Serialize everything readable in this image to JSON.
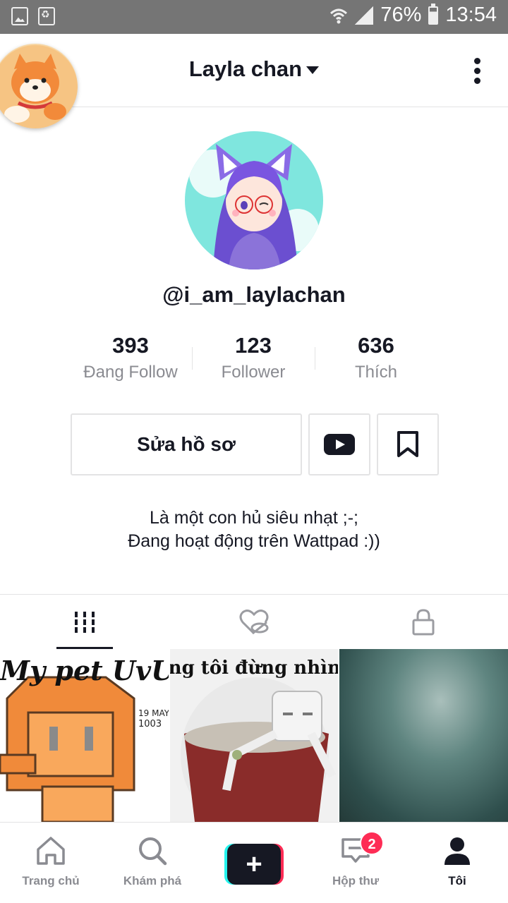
{
  "status_bar": {
    "battery": "76%",
    "time": "13:54"
  },
  "header": {
    "title": "Layla chan"
  },
  "profile": {
    "username": "@i_am_laylachan",
    "stats": [
      {
        "value": "393",
        "label": "Đang Follow"
      },
      {
        "value": "123",
        "label": "Follower"
      },
      {
        "value": "636",
        "label": "Thích"
      }
    ],
    "edit_button": "Sửa hồ sơ",
    "bio_line1": "Là một con hủ siêu nhạt ;-;",
    "bio_line2": "Đang hoạt động trên Wattpad :))"
  },
  "videos": [
    {
      "caption": "My pet UvU"
    },
    {
      "caption": "ng tôi đừng nhìn nữa"
    },
    {
      "caption": ""
    }
  ],
  "bottom_nav": {
    "items": [
      {
        "label": "Trang chủ"
      },
      {
        "label": "Khám phá"
      },
      {
        "label": "Hộp thư",
        "badge": "2"
      },
      {
        "label": "Tôi"
      }
    ]
  },
  "colors": {
    "accent_red": "#fe2c55",
    "accent_cyan": "#25f4ee",
    "text_primary": "#161823",
    "text_secondary": "#8a8b91"
  }
}
